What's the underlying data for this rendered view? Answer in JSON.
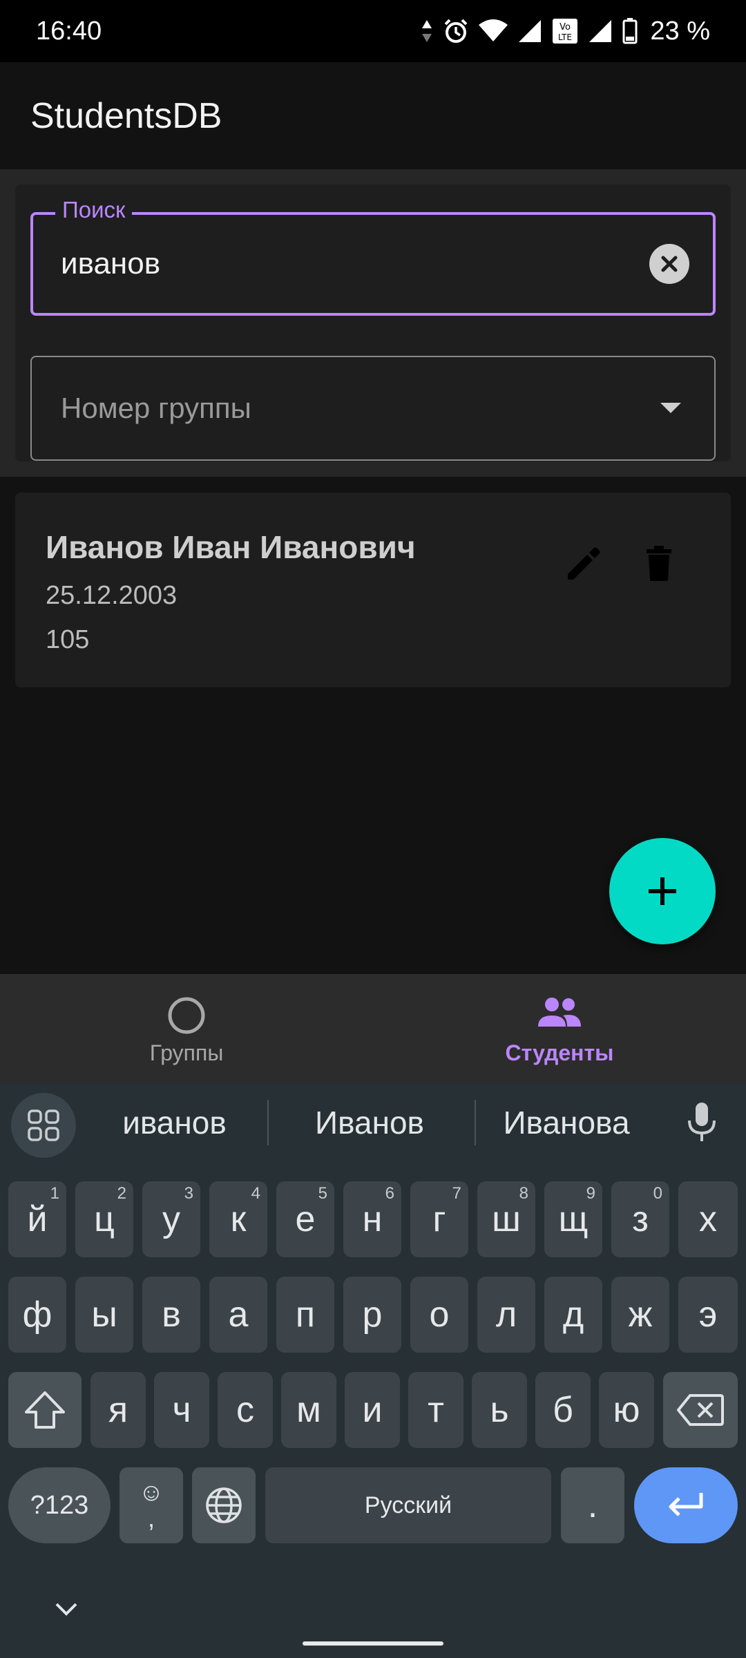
{
  "status_bar": {
    "time": "16:40",
    "battery": "23 %",
    "icons": [
      "data-arrows-icon",
      "alarm-icon",
      "wifi-icon",
      "signal-icon",
      "volte-icon",
      "signal-icon",
      "battery-icon"
    ]
  },
  "app_bar": {
    "title": "StudentsDB"
  },
  "search": {
    "label": "Поиск",
    "value": "иванов"
  },
  "group_filter": {
    "placeholder": "Номер группы"
  },
  "students": [
    {
      "name": "Иванов Иван Иванович",
      "birth_date": "25.12.2003",
      "group": "105"
    }
  ],
  "bottom_nav": {
    "items": [
      {
        "label": "Группы",
        "icon": "circle-icon",
        "active": false
      },
      {
        "label": "Студенты",
        "icon": "people-icon",
        "active": true
      }
    ]
  },
  "keyboard": {
    "suggestions": [
      "иванов",
      "Иванов",
      "Иванова"
    ],
    "row1": [
      {
        "k": "й",
        "h": "1"
      },
      {
        "k": "ц",
        "h": "2"
      },
      {
        "k": "у",
        "h": "3"
      },
      {
        "k": "к",
        "h": "4"
      },
      {
        "k": "е",
        "h": "5"
      },
      {
        "k": "н",
        "h": "6"
      },
      {
        "k": "г",
        "h": "7"
      },
      {
        "k": "ш",
        "h": "8"
      },
      {
        "k": "щ",
        "h": "9"
      },
      {
        "k": "з",
        "h": "0"
      },
      {
        "k": "х",
        "h": ""
      }
    ],
    "row2": [
      "ф",
      "ы",
      "в",
      "а",
      "п",
      "р",
      "о",
      "л",
      "д",
      "ж",
      "э"
    ],
    "row3": [
      "я",
      "ч",
      "с",
      "м",
      "и",
      "т",
      "ь",
      "б",
      "ю"
    ],
    "symbols_label": "?123",
    "emoji_comma": "☺",
    "comma": ",",
    "space_label": "Русский",
    "period": "."
  },
  "colors": {
    "accent_purple": "#bb86fc",
    "fab_teal": "#03dac5",
    "enter_blue": "#5e97f6"
  }
}
